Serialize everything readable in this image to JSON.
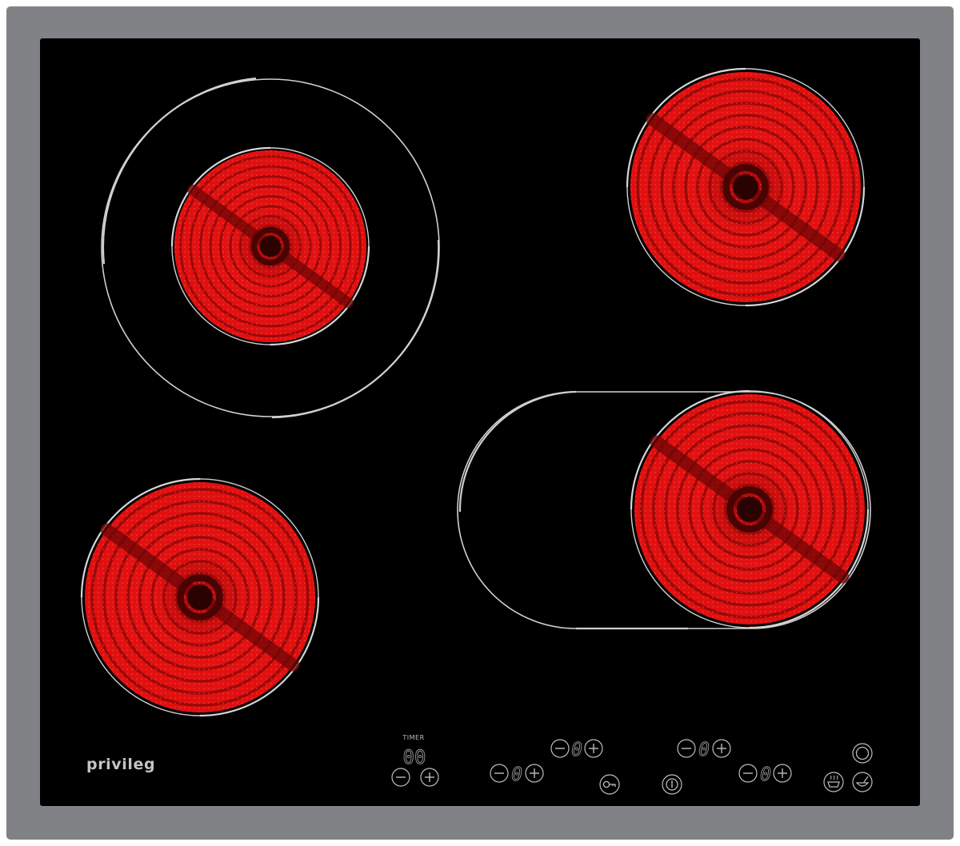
{
  "brand": "privileg",
  "timer": {
    "label": "TIMER",
    "display": "00"
  },
  "zones": {
    "top_left": {
      "level_display": "0"
    },
    "bottom_left": {
      "level_display": "0"
    },
    "top_right": {
      "level_display": "0"
    },
    "bottom_right": {
      "level_display": "0"
    }
  },
  "icons": {
    "minus": "minus-icon",
    "plus": "plus-icon",
    "key_lock": "key-lock-icon",
    "power": "power-icon",
    "dual_zone": "dual-zone-icon",
    "warming": "warming-icon",
    "pan": "pan-icon"
  },
  "colors": {
    "frame": "#808285",
    "glass": "#000000",
    "burner": "#e01010",
    "burner_dark": "#7a0606",
    "line": "#c8c8c8",
    "control": "#bdbdbd"
  }
}
